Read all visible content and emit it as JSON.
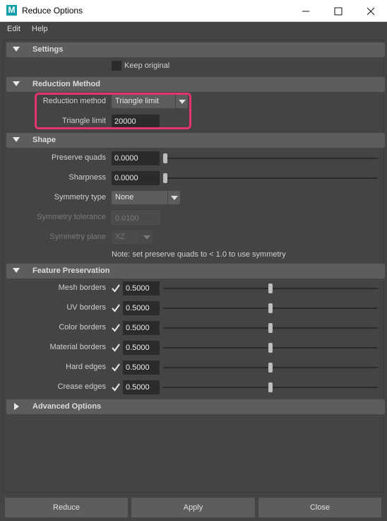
{
  "window": {
    "app_icon_letter": "M",
    "title": "Reduce Options",
    "minimize_icon": "minimize-icon",
    "maximize_icon": "maximize-icon",
    "close_icon": "close-icon"
  },
  "menu": [
    "Edit",
    "Help"
  ],
  "sections": {
    "settings": {
      "title": "Settings",
      "keep_original_label": "Keep original",
      "keep_original_checked": false
    },
    "reduction": {
      "title": "Reduction Method",
      "method_label": "Reduction method",
      "method_value": "Triangle limit",
      "triangle_label": "Triangle limit",
      "triangle_value": "20000"
    },
    "shape": {
      "title": "Shape",
      "preserve_quads_label": "Preserve quads",
      "preserve_quads_value": "0.0000",
      "sharpness_label": "Sharpness",
      "sharpness_value": "0.0000",
      "symmetry_type_label": "Symmetry type",
      "symmetry_type_value": "None",
      "symmetry_tolerance_label": "Symmetry tolerance",
      "symmetry_tolerance_value": "0.0100",
      "symmetry_plane_label": "Symmetry plane",
      "symmetry_plane_value": "XZ",
      "note": "Note: set preserve quads to < 1.0 to use symmetry"
    },
    "feature": {
      "title": "Feature Preservation",
      "rows": [
        {
          "label": "Mesh borders",
          "value": "0.5000",
          "checked": true
        },
        {
          "label": "UV borders",
          "value": "0.5000",
          "checked": true
        },
        {
          "label": "Color borders",
          "value": "0.5000",
          "checked": true
        },
        {
          "label": "Material borders",
          "value": "0.5000",
          "checked": true
        },
        {
          "label": "Hard edges",
          "value": "0.5000",
          "checked": true
        },
        {
          "label": "Crease edges",
          "value": "0.5000",
          "checked": true
        }
      ]
    },
    "advanced": {
      "title": "Advanced Options"
    }
  },
  "buttons": {
    "reduce": "Reduce",
    "apply": "Apply",
    "close": "Close"
  },
  "colors": {
    "highlight": "#e5356f",
    "panel": "#444444",
    "header": "#5d5d5d",
    "field": "#2b2b2b"
  }
}
